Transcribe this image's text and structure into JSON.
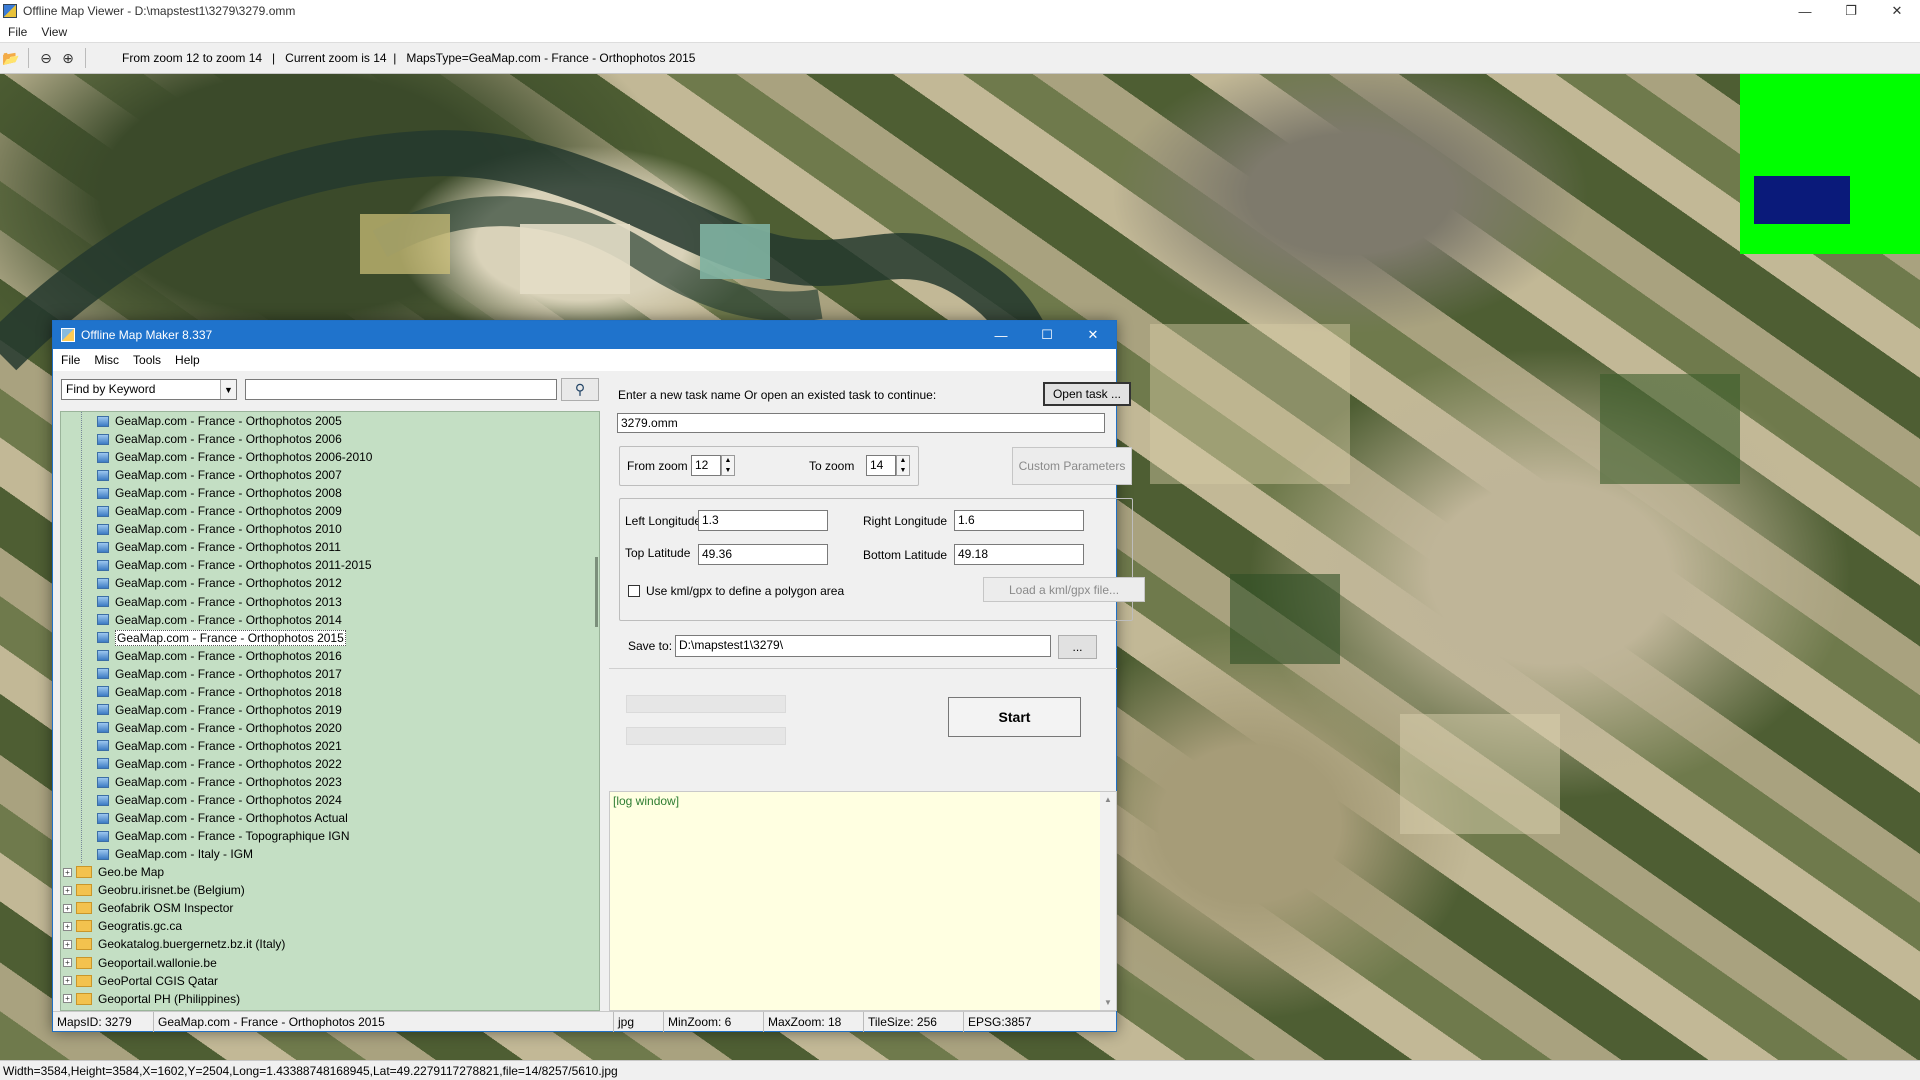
{
  "window": {
    "title": "Offline Map Viewer - D:\\mapstest1\\3279\\3279.omm",
    "menu": [
      "File",
      "View"
    ]
  },
  "toolbar": {
    "info": "From zoom 12 to zoom 14   |   Current zoom is 14  |   MapsType=GeaMap.com - France - Orthophotos 2015",
    "icons": [
      "folder-open-icon",
      "zoom-out-icon",
      "zoom-in-icon"
    ]
  },
  "status": {
    "text": "Width=3584,Height=3584,X=1602,Y=2504,Long=1.43388748168945,Lat=49.2279117278821,file=14/8257/5610.jpg"
  },
  "minimap": {
    "bg": "#00ff00",
    "viewport": "#0a1a7a"
  },
  "dialog": {
    "title": "Offline Map Maker 8.337",
    "menu": [
      "File",
      "Misc",
      "Tools",
      "Help"
    ],
    "find_select": "Find by Keyword",
    "tree_maps": [
      "GeaMap.com - France - Orthophotos 2005",
      "GeaMap.com - France - Orthophotos 2006",
      "GeaMap.com - France - Orthophotos 2006-2010",
      "GeaMap.com - France - Orthophotos 2007",
      "GeaMap.com - France - Orthophotos 2008",
      "GeaMap.com - France - Orthophotos 2009",
      "GeaMap.com - France - Orthophotos 2010",
      "GeaMap.com - France - Orthophotos 2011",
      "GeaMap.com - France - Orthophotos 2011-2015",
      "GeaMap.com - France - Orthophotos 2012",
      "GeaMap.com - France - Orthophotos 2013",
      "GeaMap.com - France - Orthophotos 2014",
      "GeaMap.com - France - Orthophotos 2015",
      "GeaMap.com - France - Orthophotos 2016",
      "GeaMap.com - France - Orthophotos 2017",
      "GeaMap.com - France - Orthophotos 2018",
      "GeaMap.com - France - Orthophotos 2019",
      "GeaMap.com - France - Orthophotos 2020",
      "GeaMap.com - France - Orthophotos 2021",
      "GeaMap.com - France - Orthophotos 2022",
      "GeaMap.com - France - Orthophotos 2023",
      "GeaMap.com - France - Orthophotos 2024",
      "GeaMap.com - France - Orthophotos Actual",
      "GeaMap.com - France - Topographique IGN",
      "GeaMap.com - Italy - IGM"
    ],
    "selected_map": "GeaMap.com - France - Orthophotos 2015",
    "tree_folders": [
      "Geo.be Map",
      "Geobru.irisnet.be (Belgium)",
      "Geofabrik OSM Inspector",
      "Geogratis.gc.ca",
      "Geokatalog.buergernetz.bz.it (Italy)",
      "Geoportail.wallonie.be",
      "GeoPortal CGIS Qatar",
      "Geoportal PH (Philippines)"
    ],
    "task_prompt": "Enter a new task name Or open an existed task to continue:",
    "open_task": "Open task ...",
    "task_name": "3279.omm",
    "from_zoom_label": "From zoom",
    "from_zoom": "12",
    "to_zoom_label": "To zoom",
    "to_zoom": "14",
    "custom_params": "Custom Parameters",
    "left_lon_label": "Left Longitude",
    "left_lon": "1.3",
    "right_lon_label": "Right Longitude",
    "right_lon": "1.6",
    "top_lat_label": "Top Latitude",
    "top_lat": "49.36",
    "bottom_lat_label": "Bottom Latitude",
    "bottom_lat": "49.18",
    "kml_check": "Use kml/gpx to define a polygon area",
    "kml_checked": false,
    "load_kml": "Load a kml/gpx file...",
    "save_label": "Save to:",
    "save_path": "D:\\mapstest1\\3279\\",
    "browse": "...",
    "start": "Start",
    "log": "[log window]",
    "status": {
      "maps_id": "MapsID: 3279",
      "map_name": "GeaMap.com - France - Orthophotos 2015",
      "format": "jpg",
      "min_zoom": "MinZoom: 6",
      "max_zoom": "MaxZoom: 18",
      "tile_size": "TileSize: 256",
      "epsg": "EPSG:3857"
    }
  }
}
